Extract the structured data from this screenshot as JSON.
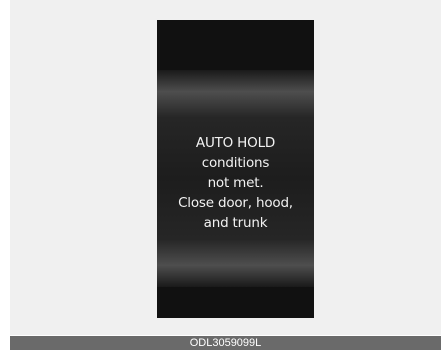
{
  "display": {
    "message_lines": [
      "AUTO HOLD",
      "conditions",
      "not met.",
      "Close door, hood,",
      "and trunk"
    ]
  },
  "caption": {
    "code": "ODL3059099L"
  },
  "colors": {
    "panel_background": "#f0f0f0",
    "display_background": "#141414",
    "text": "#f2f2f2",
    "caption_bar": "#6a6a6a"
  }
}
